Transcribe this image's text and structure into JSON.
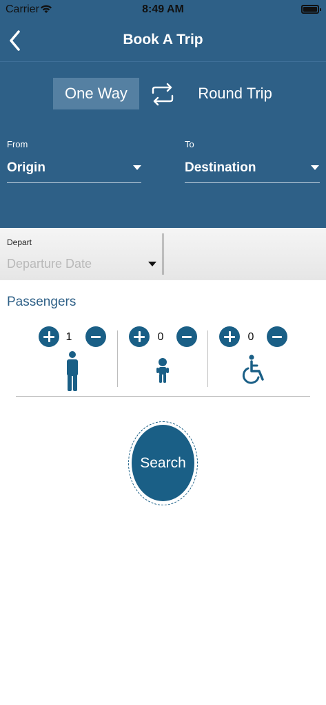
{
  "status": {
    "carrier": "Carrier",
    "time": "8:49 AM"
  },
  "header": {
    "title": "Book A Trip"
  },
  "trip_type": {
    "one_way": "One Way",
    "round_trip": "Round Trip",
    "selected": "One Way"
  },
  "from": {
    "label": "From",
    "value": "Origin"
  },
  "to": {
    "label": "To",
    "value": "Destination"
  },
  "depart": {
    "label": "Depart",
    "placeholder": "Departure Date"
  },
  "passengers": {
    "title": "Passengers",
    "groups": [
      {
        "type": "adult",
        "count": "1",
        "icon": "adult-person-icon"
      },
      {
        "type": "child",
        "count": "0",
        "icon": "child-icon"
      },
      {
        "type": "wheelchair",
        "count": "0",
        "icon": "wheelchair-icon"
      }
    ]
  },
  "search": {
    "label": "Search"
  },
  "colors": {
    "header_bg": "#2e6087",
    "selected_tab": "#5580a2",
    "accent": "#1a5f86"
  }
}
